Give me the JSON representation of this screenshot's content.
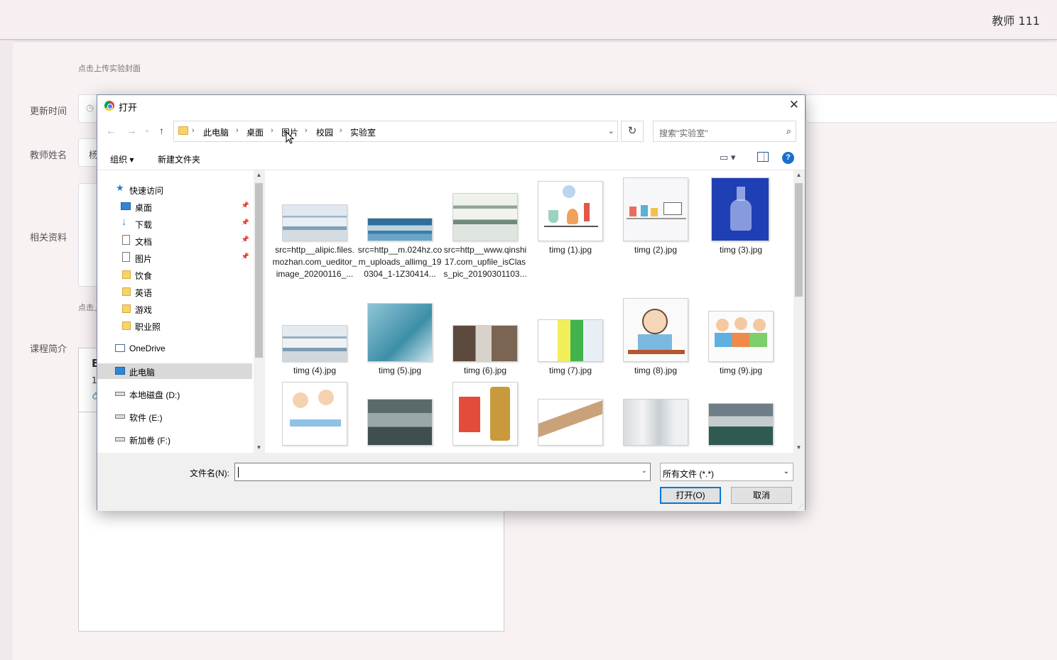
{
  "page": {
    "user_label": "教师 111",
    "upload_cover_hint": "点击上传实验封面",
    "field_update_time": "更新时间",
    "field_teacher_name": "教师姓名",
    "teacher_name_partial": "杨",
    "field_related_materials": "相关资料",
    "upload_materials_hint_partial": "点击上",
    "field_course_intro": "课程简介",
    "editor_bold_partial": "B",
    "editor_size_partial": "1"
  },
  "dialog": {
    "title": "打开",
    "close_glyph": "✕",
    "nav": {
      "back": "←",
      "forward": "→",
      "recent": "⌄",
      "up": "↑"
    },
    "breadcrumbs": [
      "此电脑",
      "桌面",
      "图片",
      "校园",
      "实验室"
    ],
    "breadcrumb_sep": "›",
    "refresh_glyph": "↻",
    "search_placeholder": "搜索\"实验室\"",
    "toolbar": {
      "organize": "组织 ▾",
      "new_folder": "新建文件夹",
      "view_glyph": "▭ ▾",
      "help": "?"
    },
    "nav_pane": {
      "quick_access": "快速访问",
      "items": [
        "桌面",
        "下载",
        "文档",
        "图片",
        "饮食",
        "英语",
        "游戏",
        "职业照"
      ],
      "onedrive": "OneDrive",
      "this_pc": "此电脑",
      "drives": [
        "本地磁盘 (D:)",
        "软件 (E:)",
        "新加卷 (F:)"
      ]
    },
    "files": [
      "src=http__alipic.files.mozhan.com_ueditor_image_20200116_...",
      "src=http__m.024hz.com_uploads_allimg_190304_1-1Z30414...",
      "src=http__www.qinshi17.com_upfile_isClass_pic_20190301103...",
      "timg (1).jpg",
      "timg (2).jpg",
      "timg (3).jpg",
      "timg (4).jpg",
      "timg (5).jpg",
      "timg (6).jpg",
      "timg (7).jpg",
      "timg (8).jpg",
      "timg (9).jpg"
    ],
    "filename_label": "文件名(N):",
    "filename_value": "",
    "filetype_value": "所有文件 (*.*)",
    "open_button": "打开(O)",
    "cancel_button": "取消"
  }
}
